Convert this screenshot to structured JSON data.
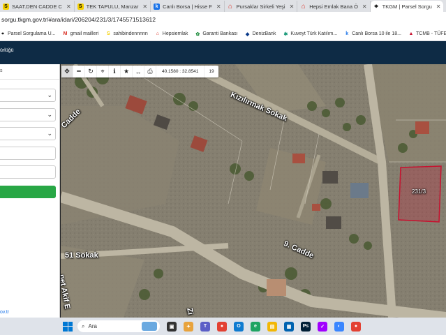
{
  "browser": {
    "tabs": [
      {
        "title": "SAAT.DEN CADDE C",
        "icon": "s-icon"
      },
      {
        "title": "TEK TAPULU, Manzar",
        "icon": "s-icon"
      },
      {
        "title": "Canlı Borsa | Hisse F",
        "icon": "k-icon"
      },
      {
        "title": "Pursaklar Sirkeli Yeşi",
        "icon": "p-icon"
      },
      {
        "title": "Hepsi Emlak Bana Ö",
        "icon": "p-icon"
      },
      {
        "title": "TKGM | Parsel Sorgu",
        "icon": "location-icon",
        "active": true
      }
    ],
    "url": "sorgu.tkgm.gov.tr/#ara/idari/206204/231/3/1745571513612",
    "bookmarks": [
      {
        "label": "Parsel Sorgulama U...",
        "icon": "location-icon"
      },
      {
        "label": "gmail mailleri",
        "icon": "gmail-icon"
      },
      {
        "label": "sahibindennnnn",
        "icon": "s-icon"
      },
      {
        "label": "Hepsiemlak",
        "icon": "p-icon"
      },
      {
        "label": "Garanti Bankası",
        "icon": "garanti-icon"
      },
      {
        "label": "DenizBank",
        "icon": "denizbank-icon"
      },
      {
        "label": "Kuveyt Türk Katılım...",
        "icon": "kuveyt-icon"
      },
      {
        "label": "Canlı Borsa 10 ile 18...",
        "icon": "k-icon"
      },
      {
        "label": "TCMB - TÜFEEEEE",
        "icon": "tcmb-icon"
      }
    ]
  },
  "site": {
    "header_text": "ürlüğü",
    "panel_header": "s",
    "footer_link": "ov.tr"
  },
  "map": {
    "toolbar": {
      "coords": "40.1580 : 32.8541",
      "zoom": "19"
    },
    "labels": {
      "street1": "Kızılırmak Sokak",
      "street2": "9. Cadde",
      "street3": "51 Sokak",
      "street4": "Cadde",
      "street5": "net Akif E",
      "street6": "Zi",
      "parcel": "231/3"
    },
    "parcel_color": "#c8102e"
  },
  "taskbar": {
    "search_placeholder": "Ara"
  }
}
